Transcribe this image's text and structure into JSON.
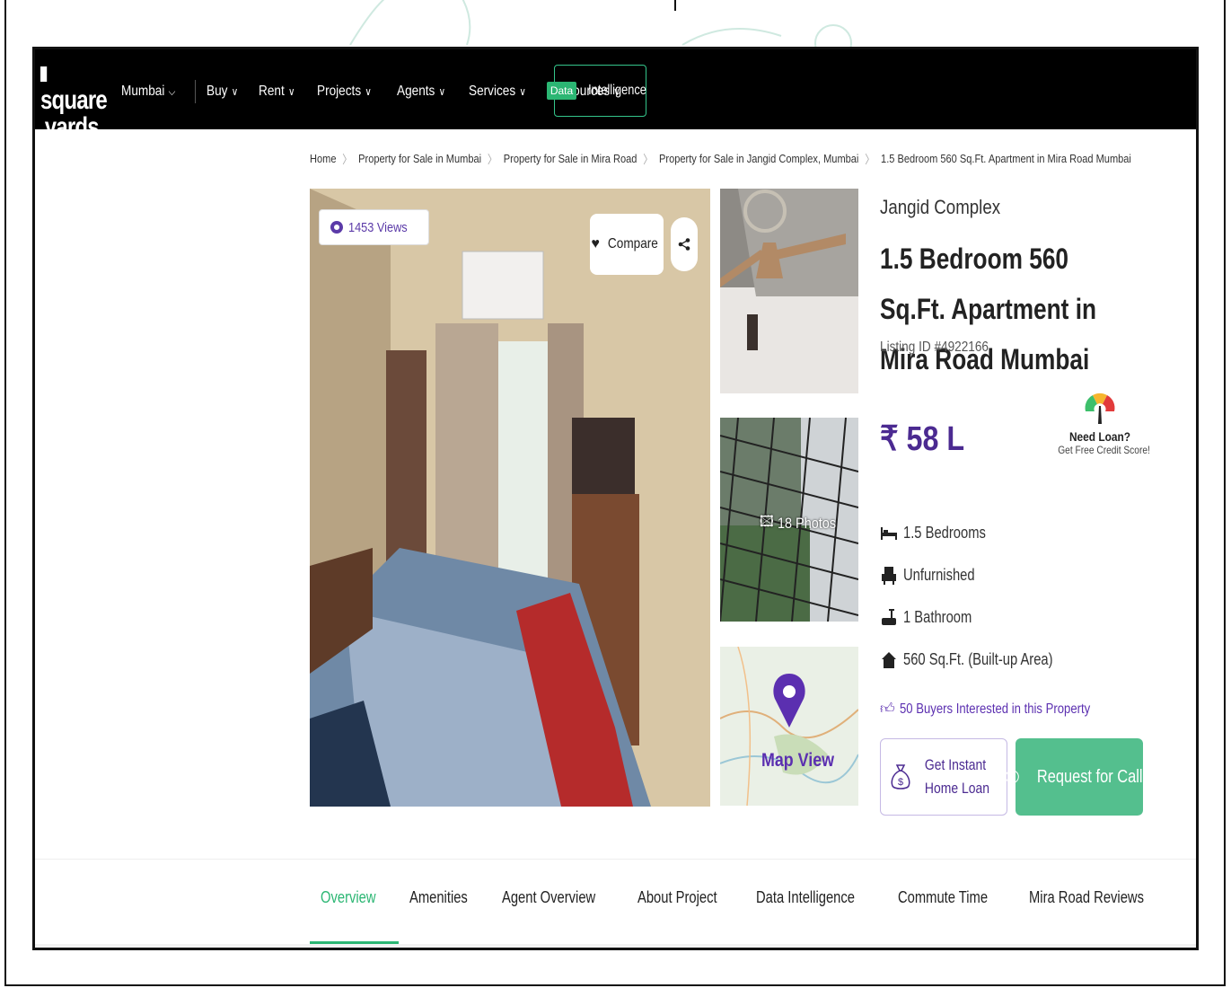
{
  "nav": {
    "logo_line1": "square",
    "logo_line2": "yards",
    "items": [
      {
        "label": "Mumbai"
      },
      {
        "label": "Buy"
      },
      {
        "label": "Rent"
      },
      {
        "label": "Projects"
      },
      {
        "label": "Agents"
      },
      {
        "label": "Services"
      },
      {
        "label": "Resources"
      }
    ],
    "data_tag": "Data",
    "data_label": "Intelligence"
  },
  "breadcrumb": [
    "Home",
    "Property for Sale in Mumbai",
    "Property for Sale in Mira Road",
    "Property for Sale in Jangid Complex, Mumbai",
    "1.5 Bedroom 560 Sq.Ft. Apartment in Mira Road Mumbai"
  ],
  "gallery": {
    "views": "1453 Views",
    "compare": "Compare",
    "photos": "18 Photos",
    "map": "Map View"
  },
  "listing": {
    "project": "Jangid Complex",
    "title": "1.5 Bedroom 560 Sq.Ft. Apartment in Mira Road Mumbai",
    "listing_id": "Listing ID #4922166",
    "price": "₹ 58 L",
    "loan_title": "Need Loan?",
    "loan_sub": "Get Free Credit Score!",
    "features": [
      {
        "icon": "bed-icon",
        "text": "1.5 Bedrooms"
      },
      {
        "icon": "armchair-icon",
        "text": "Unfurnished"
      },
      {
        "icon": "bathtub-icon",
        "text": "1 Bathroom"
      },
      {
        "icon": "home-icon",
        "text": "560 Sq.Ft. (Built-up Area)"
      }
    ],
    "interested": "50 Buyers Interested in this Property",
    "home_loan_line1": "Get Instant",
    "home_loan_line2": "Home Loan",
    "call": "Request for Call"
  },
  "tabs": [
    {
      "label": "Overview",
      "active": true
    },
    {
      "label": "Amenities"
    },
    {
      "label": "Agent Overview"
    },
    {
      "label": "About Project"
    },
    {
      "label": "Data Intelligence"
    },
    {
      "label": "Commute Time"
    },
    {
      "label": "Mira Road Reviews"
    }
  ],
  "colors": {
    "brand_purple": "#4b2a91",
    "brand_green": "#2bb673",
    "nav_bg": "#000000"
  }
}
